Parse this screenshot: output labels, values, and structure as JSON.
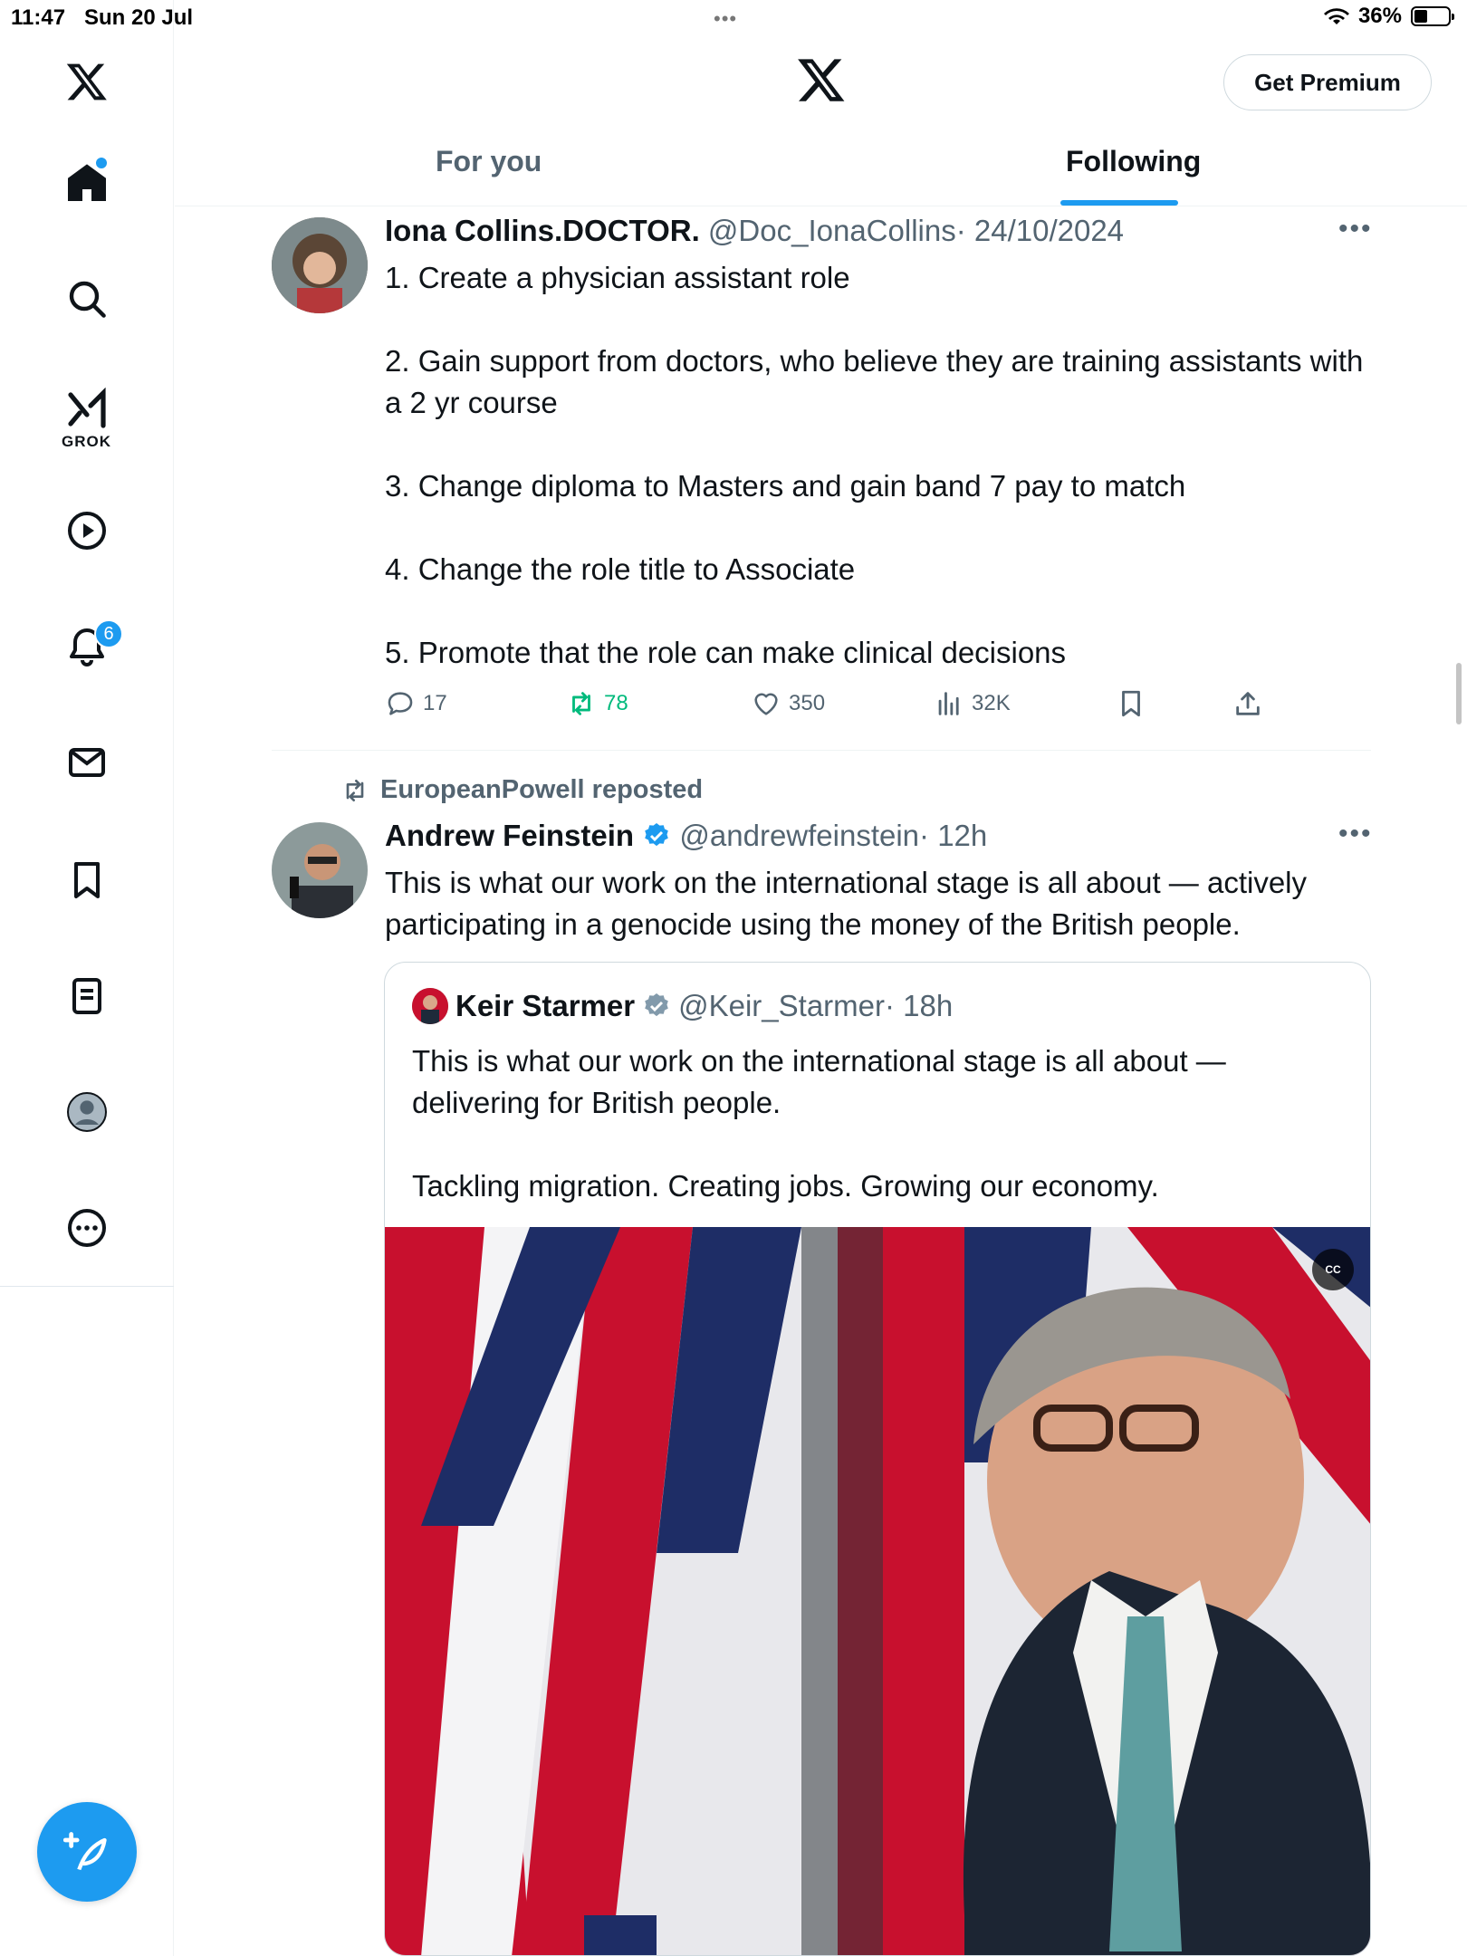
{
  "status_bar": {
    "time": "11:47",
    "date": "Sun 20 Jul",
    "dots": "•••",
    "battery": "36%"
  },
  "sidebar": {
    "items": [
      {
        "name": "home",
        "icon": "home-icon"
      },
      {
        "name": "explore",
        "icon": "search-icon"
      },
      {
        "name": "grok",
        "icon": "grok-icon",
        "label": "GROK"
      },
      {
        "name": "videos",
        "icon": "play-icon"
      },
      {
        "name": "notifications",
        "icon": "bell-icon",
        "badge": "6"
      },
      {
        "name": "messages",
        "icon": "mail-icon"
      },
      {
        "name": "bookmarks",
        "icon": "bookmark-icon"
      },
      {
        "name": "lists",
        "icon": "list-icon"
      },
      {
        "name": "profile",
        "icon": "profile-icon"
      },
      {
        "name": "more",
        "icon": "more-circle-icon"
      }
    ]
  },
  "header": {
    "premium_label": "Get Premium",
    "tabs": [
      {
        "label": "For you",
        "active": false
      },
      {
        "label": "Following",
        "active": true
      }
    ]
  },
  "tweets": [
    {
      "name": "Iona Collins.DOCTOR.",
      "handle": "@Doc_IonaCollins",
      "time": "· 24/10/2024",
      "paragraphs": [
        "1. Create a physician assistant role",
        "2. Gain support from doctors, who believe they are training assistants with a 2 yr course",
        "3. Change diploma to Masters and gain band 7 pay to match",
        "4. Change the role title to Associate",
        "5. Promote that the role can make clinical decisions"
      ],
      "stats": {
        "replies": "17",
        "reposts": "78",
        "likes": "350",
        "views": "32K"
      }
    },
    {
      "repost_label": "EuropeanPowell reposted",
      "name": "Andrew Feinstein",
      "handle": "@andrewfeinstein",
      "time": "· 12h",
      "text": "This is what our work on the international stage is all about — actively participating in a genocide using the money of the British people.",
      "quote": {
        "name": "Keir Starmer",
        "handle": "@Keir_Starmer",
        "time": "· 18h",
        "paragraphs": [
          "This is what our work on the international stage is all about — delivering for British people.",
          "Tackling migration. Creating jobs. Growing our economy."
        ],
        "cc_label": "CC"
      }
    }
  ],
  "more_label": "•••",
  "colors": {
    "accent": "#1d9bf0",
    "repost": "#00ba7c",
    "muted": "#536471"
  }
}
